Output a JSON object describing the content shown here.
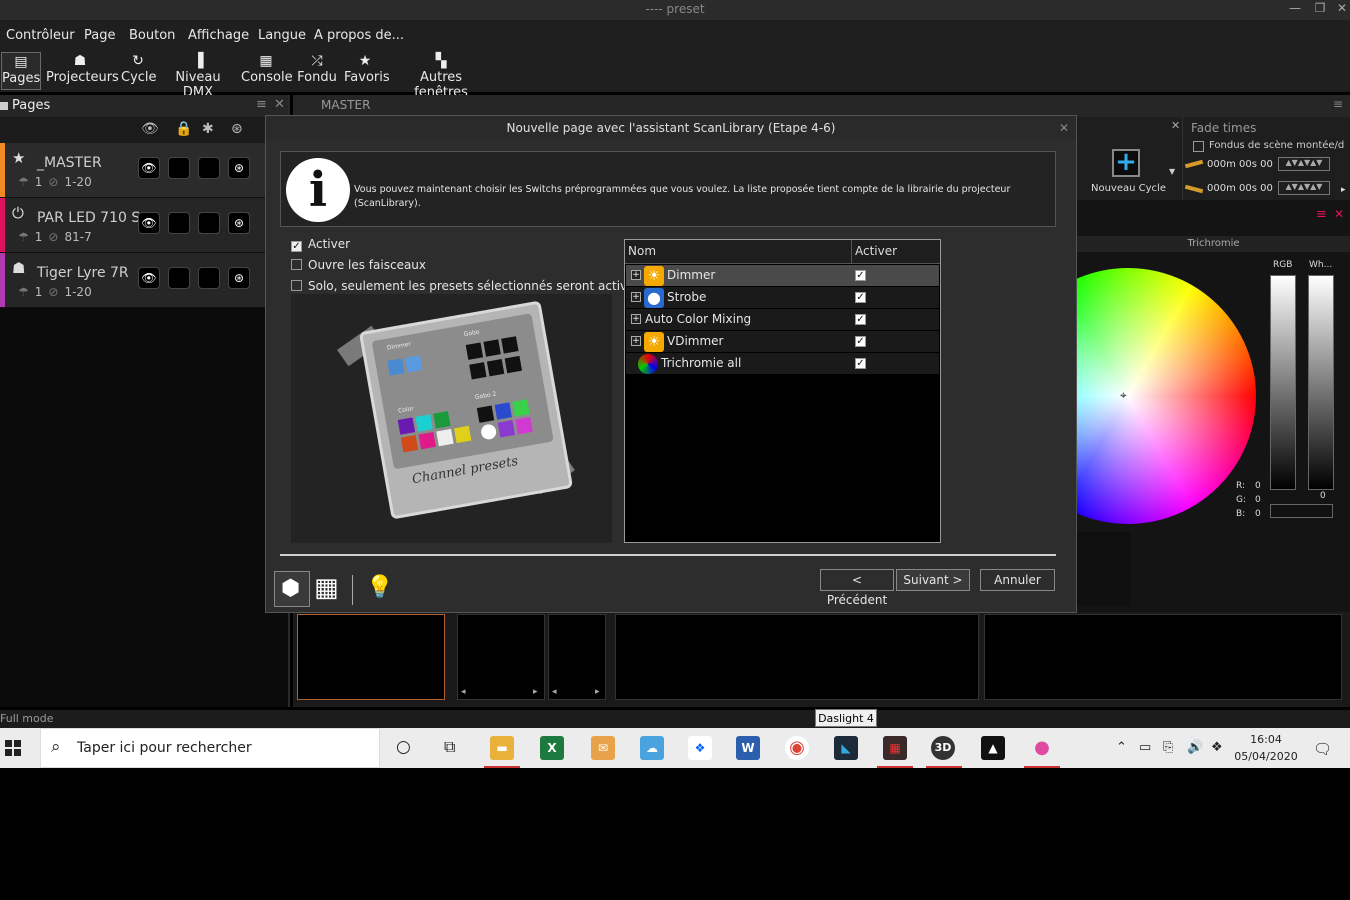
{
  "window": {
    "title": "---- preset"
  },
  "menu": [
    "Contrôleur",
    "Page",
    "Bouton",
    "Affichage",
    "Langue",
    "A propos de..."
  ],
  "toolbar": [
    {
      "label": "Pages",
      "icon": "pages-icon"
    },
    {
      "label": "Projecteurs",
      "icon": "projector-icon"
    },
    {
      "label": "Cycle",
      "icon": "cycle-icon"
    },
    {
      "label": "Niveau DMX",
      "icon": "dmx-level-icon"
    },
    {
      "label": "Console",
      "icon": "console-icon"
    },
    {
      "label": "Fondu",
      "icon": "shuffle-icon"
    },
    {
      "label": "Favoris",
      "icon": "star-icon"
    },
    {
      "label": "Autres fenêtres",
      "icon": "windows-icon"
    }
  ],
  "pages_panel": {
    "title": "Pages",
    "items": [
      {
        "name": "_MASTER",
        "num": "1",
        "range": "1-20",
        "color": "#f08a24"
      },
      {
        "name": "PAR LED 710 S",
        "num": "1",
        "range": "81-7",
        "color": "#e0115f"
      },
      {
        "name": "Tiger Lyre 7R",
        "num": "1",
        "range": "1-20",
        "color": "#b03ab0"
      }
    ]
  },
  "master_tab": {
    "title": "MASTER"
  },
  "new_cycle": {
    "label": "Nouveau Cycle"
  },
  "fade_times": {
    "title": "Fade times",
    "checkbox_label": "Fondus de scène montée/d",
    "time1": "000m 00s 00",
    "time2": "000m 00s 00"
  },
  "trichromie": {
    "title": "Trichromie",
    "rgb_label": "RGB",
    "white_label": "Wh...",
    "r_label": "R:",
    "r_value": "0",
    "g_label": "G:",
    "g_value": "0",
    "b_label": "B:",
    "b_value": "0",
    "slider_value": "0"
  },
  "dialog": {
    "title": "Nouvelle page avec l'assistant ScanLibrary (Etape 4-6)",
    "info": "Vous pouvez maintenant choisir les Switchs préprogrammées que vous voulez. La liste proposée tient compte de la librairie du projecteur (ScanLibrary).",
    "options": [
      {
        "label": "Activer",
        "checked": true
      },
      {
        "label": "Ouvre les faisceaux",
        "checked": false
      },
      {
        "label": "Solo, seulement les presets sélectionnés seront activé",
        "checked": false
      }
    ],
    "preview": {
      "caption": "Channel presets",
      "dimmer": "Dimmer",
      "gobo": "Gobo",
      "gobo2": "Gobo 2",
      "color": "Color"
    },
    "table": {
      "col_name": "Nom",
      "col_active": "Activer",
      "rows": [
        {
          "name": "Dimmer",
          "icon": "dimmer-icon",
          "checked": true,
          "selected": true
        },
        {
          "name": "Strobe",
          "icon": "strobe-icon",
          "checked": true,
          "selected": false
        },
        {
          "name": "Auto Color Mixing",
          "icon": "",
          "checked": true,
          "selected": false
        },
        {
          "name": "VDimmer",
          "icon": "vdimmer-icon",
          "checked": true,
          "selected": false
        },
        {
          "name": "Trichromie all",
          "icon": "color-wheel-icon",
          "checked": true,
          "selected": false
        }
      ]
    },
    "buttons": {
      "prev": "< Précédent",
      "next": "Suivant >",
      "cancel": "Annuler"
    }
  },
  "status": {
    "mode": "Full mode"
  },
  "tooltip": "Daslight 4",
  "taskbar": {
    "search_placeholder": "Taper ici pour rechercher",
    "time": "16:04",
    "date": "05/04/2020"
  }
}
